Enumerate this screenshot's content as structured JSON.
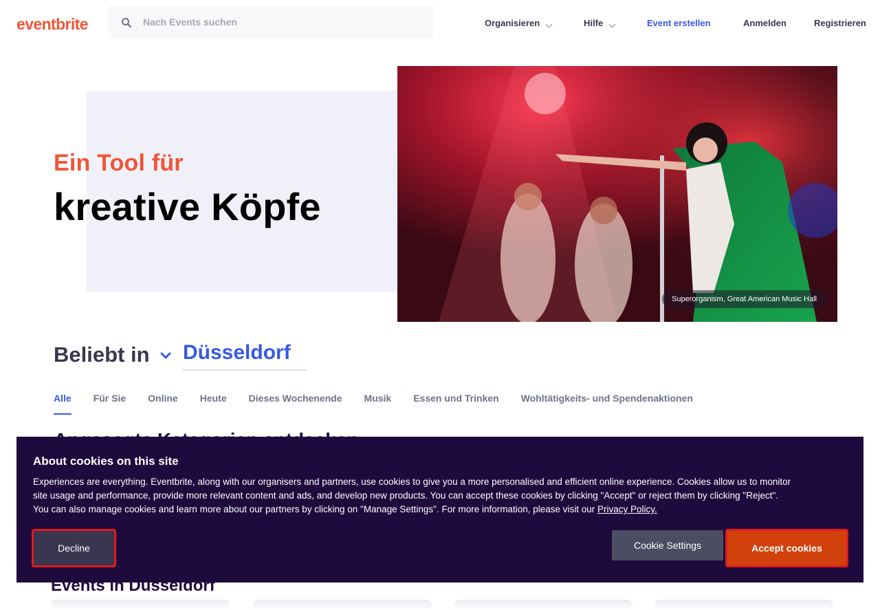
{
  "header": {
    "logo": "eventbrite",
    "search_placeholder": "Nach Events suchen",
    "nav": {
      "organize": "Organisieren",
      "help": "Hilfe",
      "create_event": "Event erstellen",
      "login": "Anmelden",
      "register": "Registrieren"
    }
  },
  "hero": {
    "line1": "Ein Tool für",
    "line2": "kreative Köpfe",
    "caption": "Superorganism, Great American Music Hall"
  },
  "popular": {
    "label": "Beliebt in",
    "city": "Düsseldorf"
  },
  "tabs": [
    {
      "label": "Alle",
      "active": true
    },
    {
      "label": "Für Sie"
    },
    {
      "label": "Online"
    },
    {
      "label": "Heute"
    },
    {
      "label": "Dieses Wochenende"
    },
    {
      "label": "Musik"
    },
    {
      "label": "Essen und Trinken"
    },
    {
      "label": "Wohltätigkeits- und Spendenaktionen"
    }
  ],
  "sections": {
    "partial_heading": "Angesagte Kategorien entdecken",
    "events_heading": "Events in Düsseldorf"
  },
  "cookie": {
    "title": "About cookies on this site",
    "text": "Experiences are everything. Eventbrite, along with our organisers and partners, use cookies to give you a more personalised and efficient online experience. Cookies allow us to monitor site usage and performance, provide more relevant content and ads, and develop new products. You can accept these cookies by clicking \"Accept\" or reject them by clicking \"Reject\". You can also manage cookies and learn more about our partners by clicking on \"Manage Settings\". For more information, please visit our ",
    "privacy_link": "Privacy Policy.",
    "decline": "Decline",
    "settings": "Cookie Settings",
    "accept": "Accept cookies"
  },
  "colors": {
    "brand": "#f05537",
    "link_blue": "#3659e3",
    "banner_bg": "#1e0a3c",
    "accept_bg": "#d1410c",
    "highlight_outline": "#e5191b"
  }
}
